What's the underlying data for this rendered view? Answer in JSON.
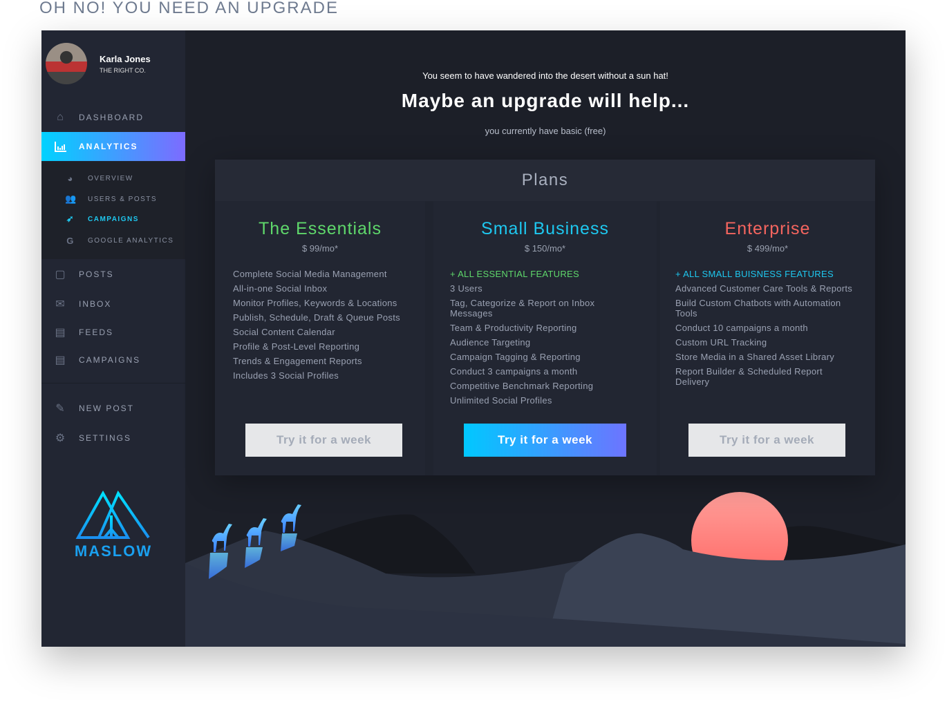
{
  "page_title": "OH NO! YOU NEED AN UPGRADE",
  "user": {
    "name": "Karla Jones",
    "company": "THE RIGHT CO."
  },
  "sidebar": {
    "nav": [
      {
        "label": "DASHBOARD",
        "icon": "home-icon"
      },
      {
        "label": "ANALYTICS",
        "icon": "bar-chart-icon",
        "active": true
      }
    ],
    "sub": [
      {
        "label": "OVERVIEW",
        "icon": "pie-chart-icon"
      },
      {
        "label": "USERS & POSTS",
        "icon": "users-icon"
      },
      {
        "label": "CAMPAIGNS",
        "icon": "rocket-icon",
        "active": true
      },
      {
        "label": "GOOGLE ANALYTICS",
        "icon": "google-icon"
      }
    ],
    "nav2": [
      {
        "label": "POSTS",
        "icon": "note-icon"
      },
      {
        "label": "INBOX",
        "icon": "mail-icon"
      },
      {
        "label": "FEEDS",
        "icon": "newspaper-icon"
      },
      {
        "label": "CAMPAIGNS",
        "icon": "newspaper-icon"
      }
    ],
    "nav3": [
      {
        "label": "NEW POST",
        "icon": "edit-icon"
      },
      {
        "label": "SETTINGS",
        "icon": "gear-icon"
      }
    ],
    "logo": "MASLOW"
  },
  "hero": {
    "line1": "You seem to have wandered into the desert without a sun hat!",
    "headline": "Maybe an upgrade will help...",
    "current": "you currently have basic (free)"
  },
  "plans": {
    "title": "Plans",
    "cards": [
      {
        "name": "The Essentials",
        "price": "$ 99/mo*",
        "color": "#5fd86b",
        "highlight": "",
        "features": [
          "Complete Social Media Management",
          "All-in-one Social Inbox",
          "Monitor Profiles, Keywords & Locations",
          "Publish, Schedule, Draft & Queue Posts",
          "Social Content Calendar",
          "Profile & Post-Level Reporting",
          "Trends & Engagement Reports",
          "Includes 3 Social Profiles"
        ],
        "button": "Try it for a week"
      },
      {
        "name": "Small Business",
        "price": "$ 150/mo*",
        "color": "#1ec8f0",
        "highlight": "+ ALL ESSENTIAL FEATURES",
        "highlight_color": "#5fd86b",
        "features": [
          "3 Users",
          "Tag, Categorize & Report on Inbox Messages",
          "Team & Productivity Reporting",
          "Audience Targeting",
          "Campaign Tagging & Reporting",
          "Conduct 3 campaigns a month",
          "Competitive Benchmark Reporting",
          "Unlimited Social Profiles"
        ],
        "button": "Try it for a week"
      },
      {
        "name": "Enterprise",
        "price": "$ 499/mo*",
        "color": "#f5655f",
        "highlight": "+ ALL SMALL BUISNESS FEATURES",
        "highlight_color": "#1ec8f0",
        "features": [
          "Advanced Customer Care Tools & Reports",
          "Build Custom Chatbots with Automation Tools",
          "Conduct 10 campaigns a month",
          "Custom URL Tracking",
          "Store Media in a Shared Asset Library",
          "Report Builder & Scheduled Report Delivery"
        ],
        "button": "Try it for a week"
      }
    ]
  }
}
